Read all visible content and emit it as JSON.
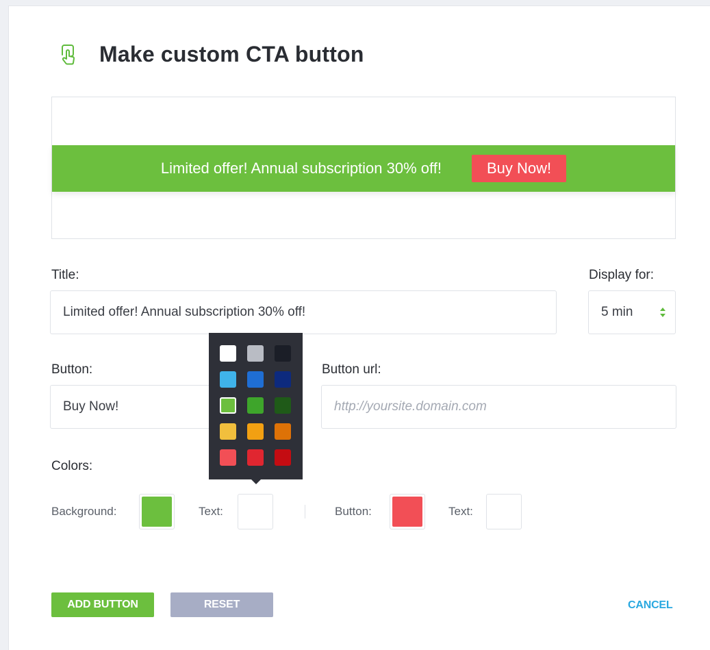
{
  "dialog": {
    "title": "Make custom CTA button",
    "icon": "pointer-hand-icon"
  },
  "preview": {
    "title": "Limited offer! Annual subscription 30% off!",
    "button": "Buy Now!",
    "background_color": "#6cbf3e",
    "text_color": "#ffffff",
    "button_color": "#f24f56",
    "button_text_color": "#ffffff"
  },
  "form": {
    "title_label": "Title:",
    "title_value": "Limited offer! Annual subscription 30% off!",
    "display_label": "Display for:",
    "display_value": "5 min",
    "button_label": "Button:",
    "button_value": "Buy Now!",
    "url_label": "Button url:",
    "url_placeholder": "http://yoursite.domain.com",
    "colors_label": "Colors:"
  },
  "colors": {
    "background_label": "Background:",
    "background_color": "#6cbf3e",
    "text_label": "Text:",
    "text_color": "#ffffff",
    "button_label": "Button:",
    "button_color": "#f24f56",
    "button_text_label": "Text:",
    "button_text_color": "#ffffff"
  },
  "palette": {
    "swatches": [
      "#ffffff",
      "#b9bcc4",
      "#1b1e27",
      "#3fb3ea",
      "#1f6ed4",
      "#0d2a7e",
      "#6cbf3e",
      "#3ea52b",
      "#1f5a18",
      "#f1bf3d",
      "#f2a012",
      "#de7207",
      "#f24f56",
      "#e02630",
      "#c40c12"
    ],
    "selected_index": 6
  },
  "actions": {
    "add_label": "ADD BUTTON",
    "add_color": "#6cbf3e",
    "reset_label": "RESET",
    "reset_color": "#a7adc5",
    "cancel_label": "CANCEL",
    "cancel_color": "#29a8e0"
  }
}
